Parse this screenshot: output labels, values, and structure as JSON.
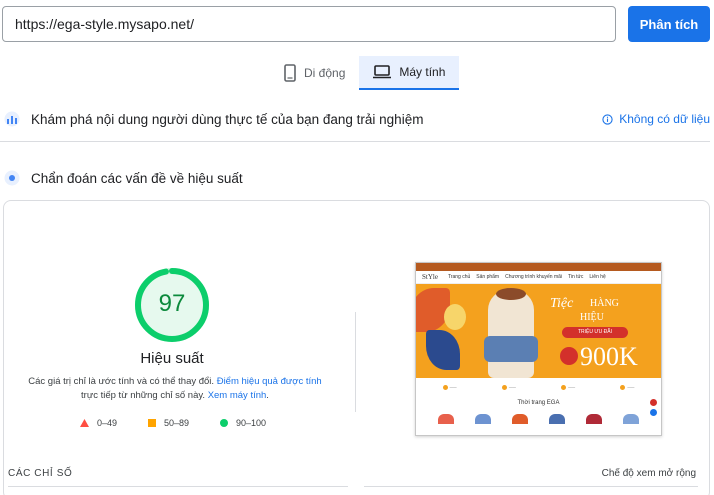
{
  "search": {
    "url_value": "https://ega-style.mysapo.net/",
    "analyze_label": "Phân tích"
  },
  "tabs": [
    {
      "label": "Di động",
      "icon": "phone-icon",
      "active": false
    },
    {
      "label": "Máy tính",
      "icon": "desktop-icon",
      "active": true
    }
  ],
  "field_data": {
    "title": "Khám phá nội dung người dùng thực tế của bạn đang trải nghiệm",
    "status": "Không có dữ liệu"
  },
  "diagnose": {
    "title": "Chẩn đoán các vấn đề về hiệu suất"
  },
  "score": {
    "value": "97",
    "fraction": 0.97,
    "label": "Hiệu suất",
    "color": "#0cce6b"
  },
  "description": {
    "pre": "Các giá trị chỉ là ước tính và có thể thay đổi. ",
    "link1": "Điểm hiệu quả được tính",
    "mid": " trực tiếp từ những chỉ số này. ",
    "link2": "Xem máy tính",
    "post": "."
  },
  "legend": [
    {
      "range": "0–49",
      "color": "#ff4e42",
      "shape": "triangle"
    },
    {
      "range": "50–89",
      "color": "#ffa400",
      "shape": "square"
    },
    {
      "range": "90–100",
      "color": "#0cce6b",
      "shape": "circle"
    }
  ],
  "preview": {
    "logo": "StYle",
    "nav": [
      "Trang chủ",
      "Sản phẩm",
      "Chương trình khuyến mãi",
      "Tin tức",
      "Liên hệ"
    ],
    "banner_script": "Tiệc",
    "banner_line1": "HÀNG",
    "banner_line2": "HIỆU",
    "banner_pill": "TRIỆU ƯU ĐÃI",
    "banner_price": "900K",
    "section_title": "Thời trang EGA"
  },
  "metrics_header": "CÁC CHỈ SỐ",
  "expand_label": "Chế độ xem mở rộng"
}
